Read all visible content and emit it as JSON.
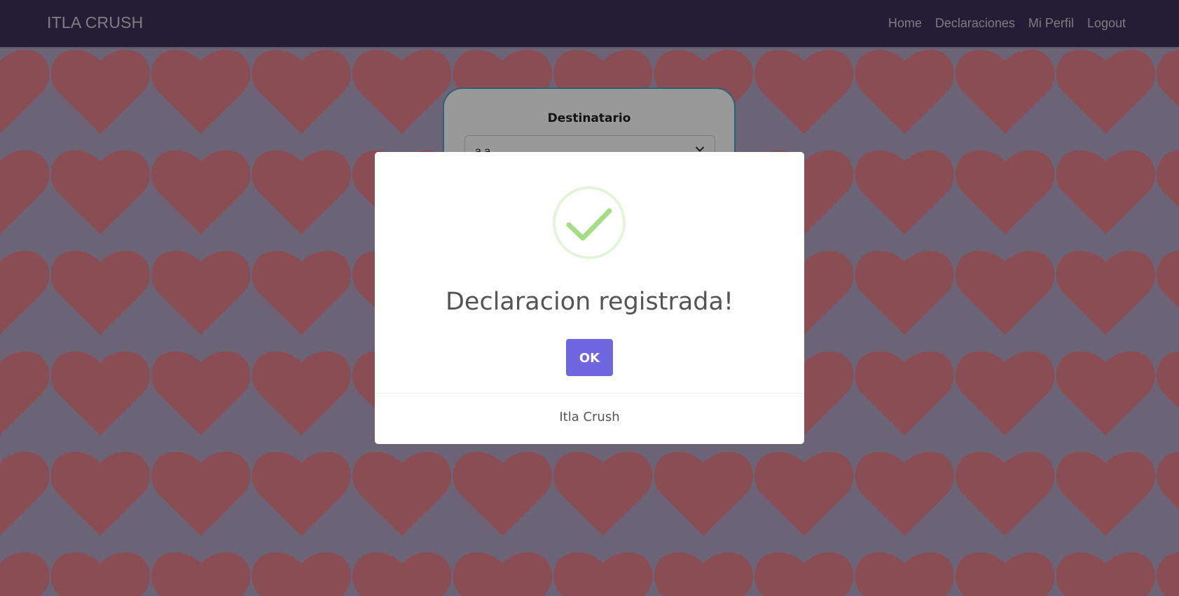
{
  "navbar": {
    "brand": "ITLA CRUSH",
    "links": [
      {
        "label": "Home"
      },
      {
        "label": "Declaraciones"
      },
      {
        "label": "Mi Perfil"
      },
      {
        "label": "Logout"
      }
    ]
  },
  "background": {
    "pattern_icon": "heart-icon",
    "heart_color": "#e7808b",
    "base_color": "#ddd0f0"
  },
  "form": {
    "destinatario_label": "Destinatario",
    "destinatario_value": "a a",
    "select_icon": "chevron-down-icon"
  },
  "dialog": {
    "icon": "success-check-icon",
    "success_color": "#a5dc86",
    "title": "Declaracion registrada!",
    "confirm_label": "OK",
    "confirm_color": "#7066e0",
    "footer": "Itla Crush"
  }
}
